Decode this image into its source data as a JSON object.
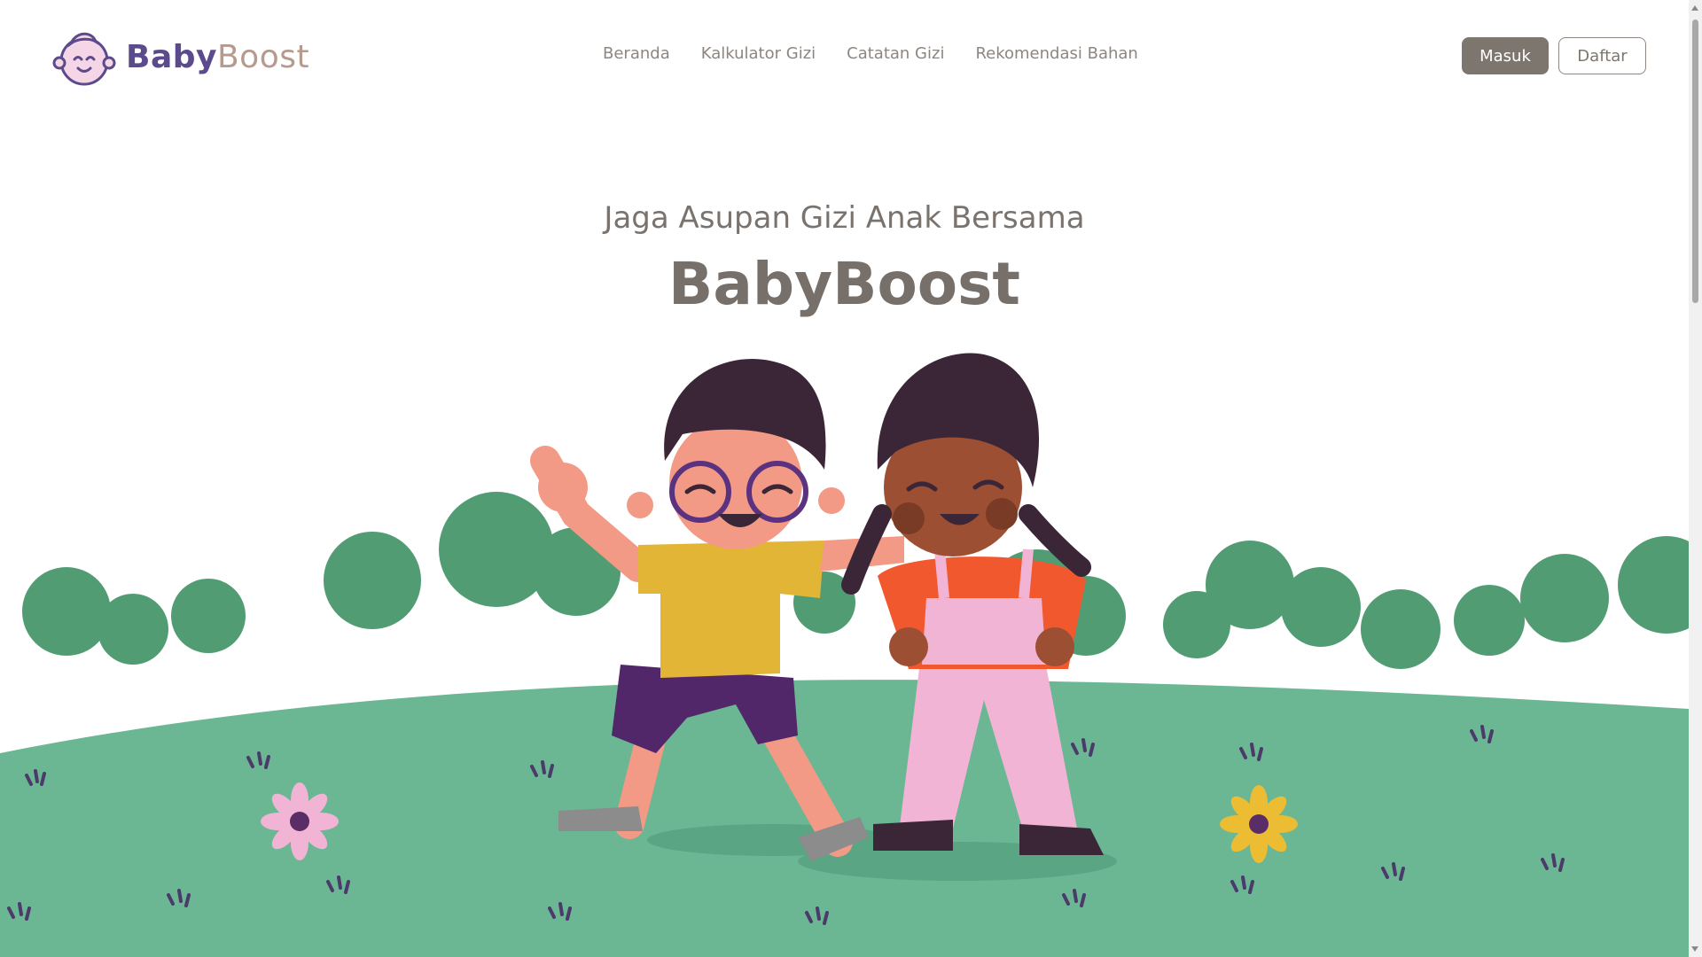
{
  "brand": {
    "name_part1": "Baby",
    "name_part2": "Boost"
  },
  "nav": {
    "items": [
      {
        "label": "Beranda"
      },
      {
        "label": "Kalkulator Gizi"
      },
      {
        "label": "Catatan Gizi"
      },
      {
        "label": "Rekomendasi Bahan"
      }
    ]
  },
  "auth": {
    "login_label": "Masuk",
    "register_label": "Daftar"
  },
  "hero": {
    "subtitle": "Jaga Asupan Gizi Anak Bersama",
    "title": "BabyBoost"
  },
  "colors": {
    "brand_purple": "#5b4a8c",
    "brand_tan": "#b79a8e",
    "button_dark": "#7d766e",
    "grass": "#6bb794",
    "bushes": "#519c73"
  }
}
